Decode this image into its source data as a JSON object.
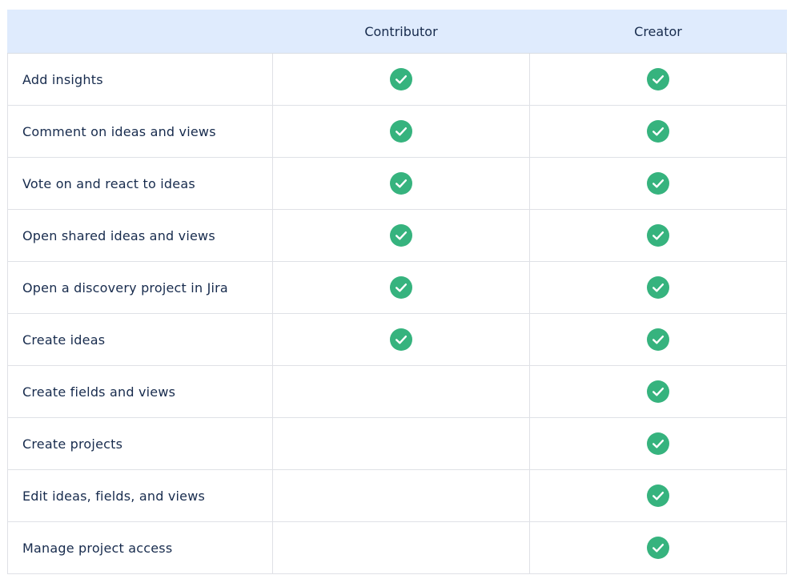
{
  "table": {
    "headers": [
      "",
      "Contributor",
      "Creator"
    ],
    "check_color": "#36b37e",
    "rows": [
      {
        "feature": "Add insights",
        "contributor": true,
        "creator": true
      },
      {
        "feature": "Comment on ideas and views",
        "contributor": true,
        "creator": true
      },
      {
        "feature": "Vote on and react to ideas",
        "contributor": true,
        "creator": true
      },
      {
        "feature": "Open shared ideas and views",
        "contributor": true,
        "creator": true
      },
      {
        "feature": "Open a discovery project in Jira",
        "contributor": true,
        "creator": true
      },
      {
        "feature": "Create ideas",
        "contributor": true,
        "creator": true
      },
      {
        "feature": "Create fields and views",
        "contributor": false,
        "creator": true
      },
      {
        "feature": "Create projects",
        "contributor": false,
        "creator": true
      },
      {
        "feature": "Edit ideas, fields, and views",
        "contributor": false,
        "creator": true
      },
      {
        "feature": "Manage project access",
        "contributor": false,
        "creator": true
      }
    ]
  }
}
